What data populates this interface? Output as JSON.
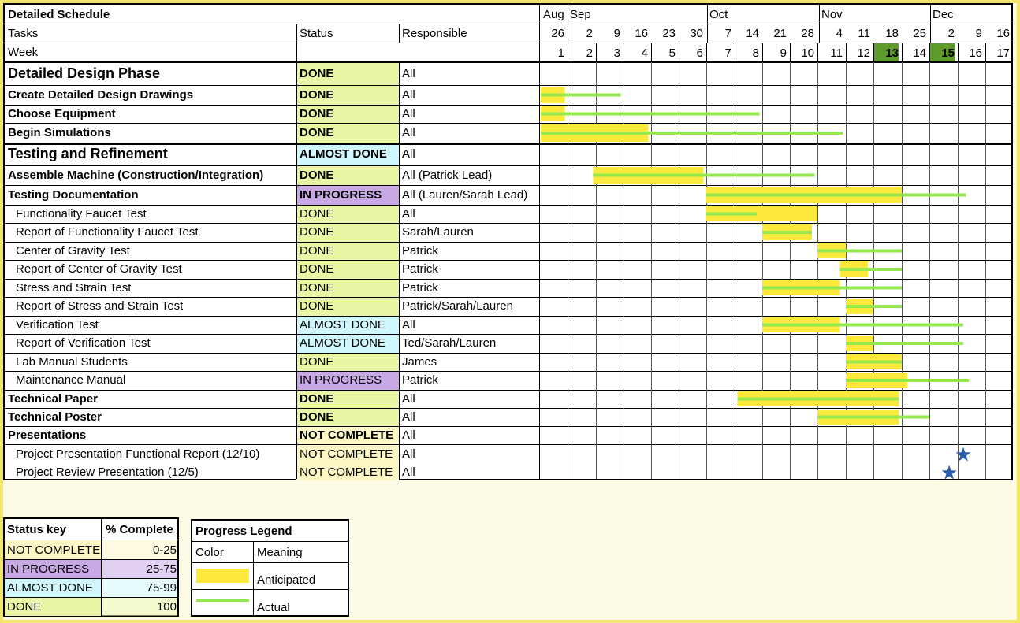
{
  "sheet_title": "Detailed Schedule",
  "headers": {
    "tasks": "Tasks",
    "status": "Status",
    "responsible": "Responsible",
    "week": "Week"
  },
  "months": [
    "Aug",
    "Sep",
    "Oct",
    "Nov",
    "Dec"
  ],
  "dates": [
    "26",
    "2",
    "9",
    "16",
    "23",
    "30",
    "7",
    "14",
    "21",
    "28",
    "4",
    "11",
    "18",
    "25",
    "2",
    "9",
    "16"
  ],
  "weeks": [
    "1",
    "2",
    "3",
    "4",
    "5",
    "6",
    "7",
    "8",
    "9",
    "10",
    "11",
    "12",
    "13",
    "14",
    "15",
    "16",
    "17"
  ],
  "highlighted_weeks": [
    "13",
    "15"
  ],
  "colors": {
    "done": "#ebf5a6",
    "almost_done": "#cff7fd",
    "in_progress": "#c9a9e5",
    "not_complete": "#fdf7c6",
    "anticipated": "#fce93b",
    "actual": "#95e94d",
    "week_highlight": "#5f9b2b",
    "milestone_star": "#2c5fa8"
  },
  "rows": [
    {
      "task": "Detailed Design Phase",
      "status": "DONE",
      "status_type": "done",
      "responsible": "All",
      "level": "phase"
    },
    {
      "task": "Create Detailed Design Drawings",
      "status": "DONE",
      "status_type": "done",
      "responsible": "All",
      "level": "bold"
    },
    {
      "task": "Choose Equipment",
      "status": "DONE",
      "status_type": "done",
      "responsible": "All",
      "level": "bold"
    },
    {
      "task": "Begin Simulations",
      "status": "DONE",
      "status_type": "done",
      "responsible": "All",
      "level": "bold"
    },
    {
      "task": "Testing and Refinement",
      "status": "ALMOST DONE",
      "status_type": "almost_done",
      "responsible": "All",
      "level": "phase"
    },
    {
      "task": "Assemble Machine (Construction/Integration)",
      "status": "DONE",
      "status_type": "done",
      "responsible": "All (Patrick Lead)",
      "level": "bold"
    },
    {
      "task": "Testing Documentation",
      "status": "IN PROGRESS",
      "status_type": "in_progress",
      "responsible": "All (Lauren/Sarah Lead)",
      "level": "bold"
    },
    {
      "task": "Functionality Faucet Test",
      "status": "DONE",
      "status_type": "done",
      "responsible": "All",
      "level": "sub"
    },
    {
      "task": "Report of Functionality Faucet Test",
      "status": "DONE",
      "status_type": "done",
      "responsible": "Sarah/Lauren",
      "level": "sub"
    },
    {
      "task": "Center of Gravity Test",
      "status": "DONE",
      "status_type": "done",
      "responsible": "Patrick",
      "level": "sub"
    },
    {
      "task": "Report of Center of Gravity Test",
      "status": "DONE",
      "status_type": "done",
      "responsible": "Patrick",
      "level": "sub"
    },
    {
      "task": "Stress and Strain Test",
      "status": "DONE",
      "status_type": "done",
      "responsible": "Patrick",
      "level": "sub"
    },
    {
      "task": "Report of Stress and Strain Test",
      "status": "DONE",
      "status_type": "done",
      "responsible": "Patrick/Sarah/Lauren",
      "level": "sub"
    },
    {
      "task": "Verification Test",
      "status": "ALMOST DONE",
      "status_type": "almost_done",
      "responsible": "All",
      "level": "sub"
    },
    {
      "task": "Report of Verification Test",
      "status": "ALMOST DONE",
      "status_type": "almost_done",
      "responsible": "Ted/Sarah/Lauren",
      "level": "sub"
    },
    {
      "task": "Lab Manual Students",
      "status": "DONE",
      "status_type": "done",
      "responsible": "James",
      "level": "sub"
    },
    {
      "task": "Maintenance Manual",
      "status": "IN PROGRESS",
      "status_type": "in_progress",
      "responsible": "Patrick",
      "level": "sub"
    },
    {
      "task": "Technical Paper",
      "status": "DONE",
      "status_type": "done",
      "responsible": "All",
      "level": "bold"
    },
    {
      "task": "Technical Poster",
      "status": "DONE",
      "status_type": "done",
      "responsible": "All",
      "level": "bold"
    },
    {
      "task": "Presentations",
      "status": "NOT COMPLETE",
      "status_type": "not_complete",
      "responsible": "All",
      "level": "bold"
    },
    {
      "task": "Project Presentation Functional Report (12/10)",
      "status": "NOT COMPLETE",
      "status_type": "not_complete",
      "responsible": "All",
      "level": "sub"
    },
    {
      "task": "Project Review Presentation (12/5)",
      "status": "NOT COMPLETE",
      "status_type": "not_complete",
      "responsible": "All",
      "level": "sub"
    }
  ],
  "chart_data": {
    "type": "gantt",
    "x_axis": "week",
    "x_range": [
      1,
      18
    ],
    "series": [
      {
        "name": "Anticipated",
        "bars": [
          {
            "row": 1,
            "start": 1.0,
            "end": 1.9
          },
          {
            "row": 2,
            "start": 1.0,
            "end": 1.9
          },
          {
            "row": 3,
            "start": 1.0,
            "end": 4.9
          },
          {
            "row": 5,
            "start": 2.9,
            "end": 6.9
          },
          {
            "row": 6,
            "start": 7.0,
            "end": 14.0
          },
          {
            "row": 7,
            "start": 7.0,
            "end": 11.0
          },
          {
            "row": 8,
            "start": 9.0,
            "end": 10.8
          },
          {
            "row": 9,
            "start": 11.0,
            "end": 12.0
          },
          {
            "row": 10,
            "start": 11.8,
            "end": 12.8
          },
          {
            "row": 11,
            "start": 9.0,
            "end": 11.8
          },
          {
            "row": 12,
            "start": 12.0,
            "end": 13.0
          },
          {
            "row": 13,
            "start": 9.0,
            "end": 11.8
          },
          {
            "row": 14,
            "start": 12.0,
            "end": 13.0
          },
          {
            "row": 15,
            "start": 12.0,
            "end": 14.0
          },
          {
            "row": 16,
            "start": 12.0,
            "end": 14.2
          },
          {
            "row": 17,
            "start": 8.1,
            "end": 13.9
          },
          {
            "row": 18,
            "start": 11.0,
            "end": 13.9
          }
        ]
      },
      {
        "name": "Actual",
        "bars": [
          {
            "row": 1,
            "start": 1.0,
            "end": 3.9
          },
          {
            "row": 2,
            "start": 1.0,
            "end": 8.9
          },
          {
            "row": 3,
            "start": 1.0,
            "end": 11.9
          },
          {
            "row": 5,
            "start": 2.9,
            "end": 10.9
          },
          {
            "row": 6,
            "start": 7.0,
            "end": 16.3
          },
          {
            "row": 7,
            "start": 7.0,
            "end": 8.8
          },
          {
            "row": 8,
            "start": 9.0,
            "end": 10.8
          },
          {
            "row": 9,
            "start": 11.0,
            "end": 14.0
          },
          {
            "row": 10,
            "start": 11.8,
            "end": 14.0
          },
          {
            "row": 11,
            "start": 9.0,
            "end": 14.0
          },
          {
            "row": 12,
            "start": 12.0,
            "end": 14.0
          },
          {
            "row": 13,
            "start": 9.0,
            "end": 16.2
          },
          {
            "row": 14,
            "start": 12.0,
            "end": 16.2
          },
          {
            "row": 15,
            "start": 12.0,
            "end": 14.0
          },
          {
            "row": 16,
            "start": 12.0,
            "end": 16.4
          },
          {
            "row": 17,
            "start": 8.1,
            "end": 13.9
          },
          {
            "row": 18,
            "start": 11.0,
            "end": 15.0
          }
        ]
      }
    ],
    "milestones": [
      {
        "row": 20,
        "week": 16.2
      },
      {
        "row": 21,
        "week": 15.7
      }
    ]
  },
  "status_key": {
    "header_status": "Status key",
    "header_pct": "% Complete",
    "rows": [
      {
        "status": "NOT COMPLETE",
        "pct": "0-25",
        "type": "not_complete"
      },
      {
        "status": "IN PROGRESS",
        "pct": "25-75",
        "type": "in_progress"
      },
      {
        "status": "ALMOST DONE",
        "pct": "75-99",
        "type": "almost_done"
      },
      {
        "status": "DONE",
        "pct": "100",
        "type": "done"
      }
    ]
  },
  "progress_legend": {
    "title": "Progress Legend",
    "col_color": "Color",
    "col_meaning": "Meaning",
    "anticipated": "Anticipated",
    "actual": "Actual"
  }
}
